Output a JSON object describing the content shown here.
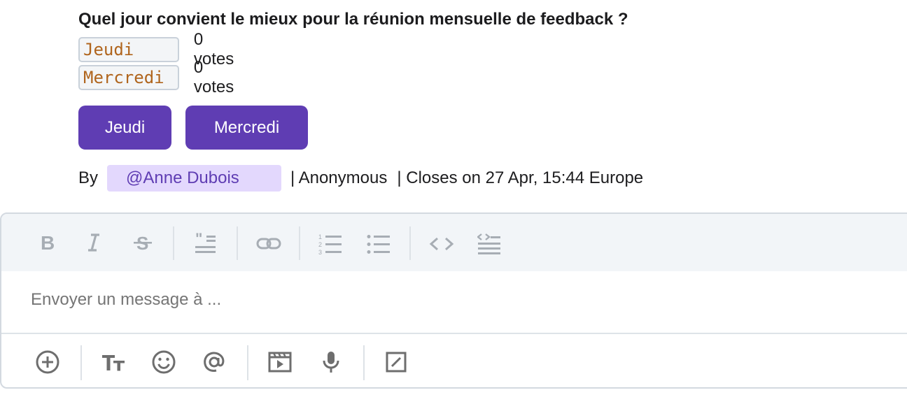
{
  "poll": {
    "question": "Quel jour convient le mieux pour la réunion mensuelle de feedback ?",
    "options": [
      {
        "label": "Jeudi",
        "votes": "0 votes"
      },
      {
        "label": "Mercredi",
        "votes": "0 votes"
      }
    ],
    "buttons": [
      "Jeudi",
      "Mercredi"
    ],
    "by_label": "By",
    "author": "@Anne Dubois",
    "anonymous": "| Anonymous",
    "closes": "| Closes on 27 Apr, 15:44 Europe"
  },
  "composer": {
    "placeholder": "Envoyer un message à ...",
    "format_icons": [
      "bold-icon",
      "italic-icon",
      "strikethrough-icon",
      "heading-icon",
      "link-icon",
      "ordered-list-icon",
      "bullet-list-icon",
      "code-icon",
      "code-block-icon"
    ],
    "bottom_icons": [
      "add-icon",
      "text-format-icon",
      "emoji-icon",
      "mention-icon",
      "gif-icon",
      "microphone-icon",
      "slash-command-icon"
    ]
  },
  "colors": {
    "accent": "#5f3db3",
    "mention_bg": "#e3d8fd",
    "code_text": "#b0651d"
  }
}
